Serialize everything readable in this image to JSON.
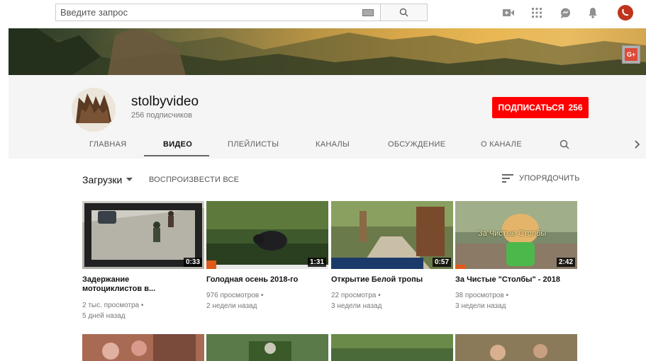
{
  "search": {
    "placeholder": "Введите запрос"
  },
  "channel": {
    "name": "stolbyvideo",
    "subscribers": "256 подписчиков",
    "subscribe_label": "ПОДПИСАТЬСЯ",
    "subscribe_count": "256"
  },
  "tabs": [
    {
      "label": "ГЛАВНАЯ"
    },
    {
      "label": "ВИДЕО"
    },
    {
      "label": "ПЛЕЙЛИСТЫ"
    },
    {
      "label": "КАНАЛЫ"
    },
    {
      "label": "ОБСУЖДЕНИЕ"
    },
    {
      "label": "О КАНАЛЕ"
    }
  ],
  "section": {
    "uploads_label": "Загрузки",
    "play_all": "ВОСПРОИЗВЕСТИ ВСЕ",
    "sort_label": "УПОРЯДОЧИТЬ"
  },
  "videos": [
    {
      "title_line1": "Задержание",
      "title_line2": "мотоциклистов в...",
      "duration": "0:33",
      "views": "2 тыс. просмотра •",
      "age": "5 дней назад"
    },
    {
      "title_line1": "Голодная осень 2018-го",
      "duration": "1:31",
      "views": "976 просмотров •",
      "age": "2 недели назад"
    },
    {
      "title_line1": "Открытие Белой тропы",
      "duration": "0:57",
      "views": "22 просмотра •",
      "age": "3 недели назад"
    },
    {
      "title_line1": "За Чистые \"Столбы\" - 2018",
      "duration": "2:42",
      "views": "38 просмотров •",
      "age": "3 недели назад",
      "overlay_text": "За Чистые Столбы"
    }
  ],
  "gplus_label": "G+",
  "colors": {
    "subscribe": "#ff0000",
    "header_bg": "#f5f5f5"
  }
}
